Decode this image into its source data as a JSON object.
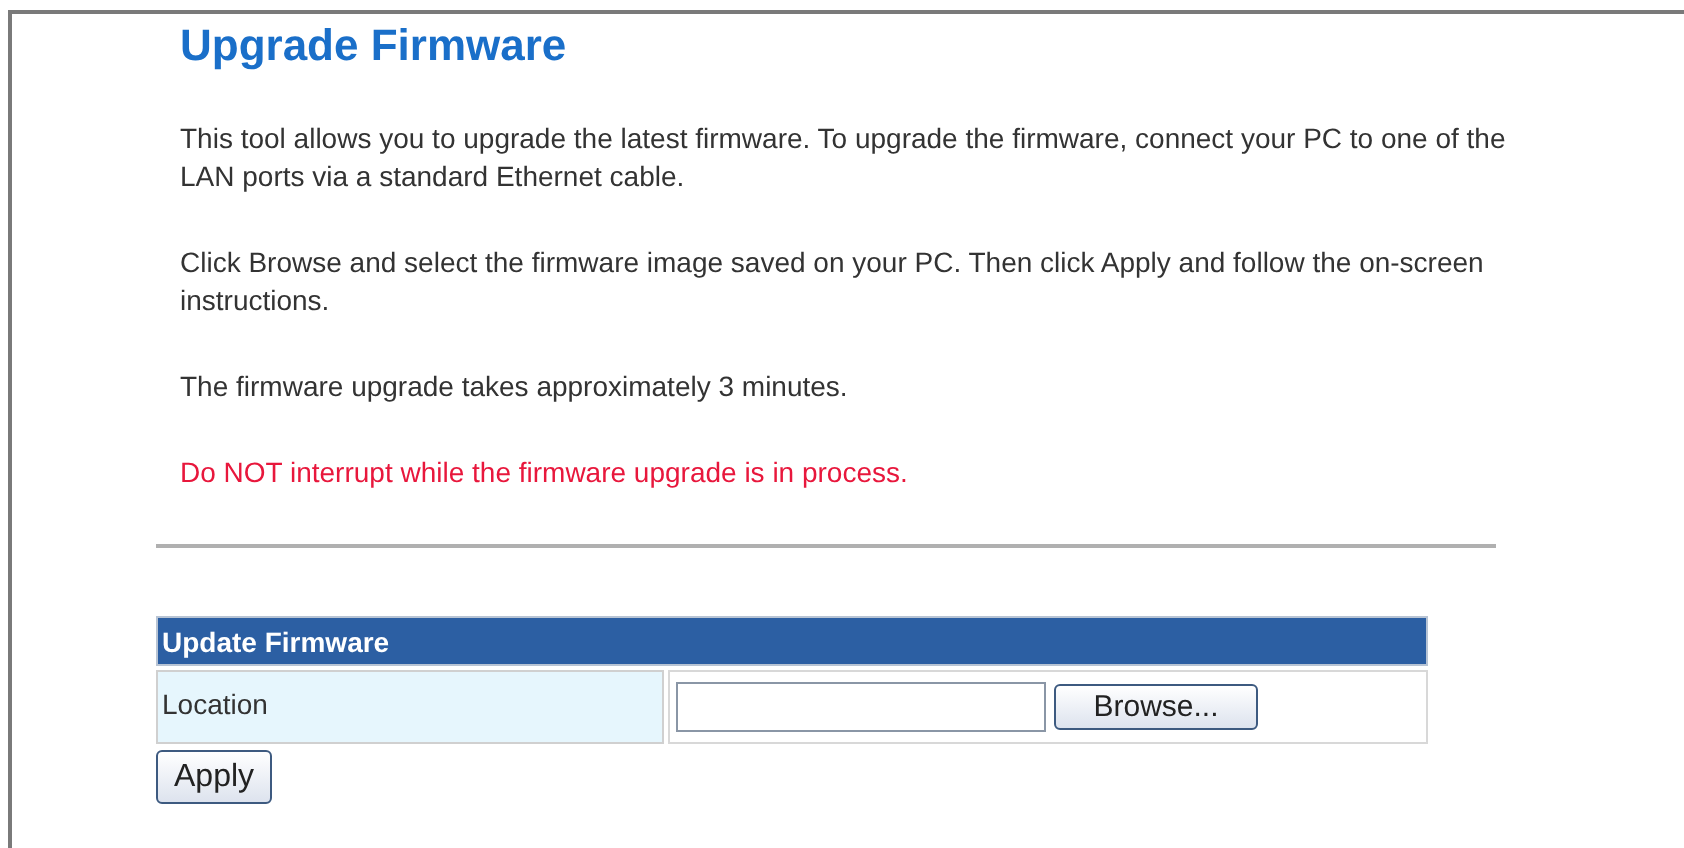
{
  "title": "Upgrade Firmware",
  "paragraphs": [
    {
      "kind": "normal",
      "text": "This tool allows you to upgrade the latest firmware. To upgrade the firmware, connect your PC to one of the LAN ports via a standard Ethernet cable."
    },
    {
      "kind": "normal",
      "text": "Click Browse and select the firmware image saved on your PC. Then click Apply and follow the on-screen instructions."
    },
    {
      "kind": "normal",
      "text": "The firmware upgrade takes approximately 3 minutes."
    },
    {
      "kind": "warning",
      "text": "Do NOT interrupt while the firmware upgrade is in process."
    }
  ],
  "form": {
    "header": "Update Firmware",
    "label": "Location",
    "browse_button": "Browse..."
  },
  "apply_button": "Apply"
}
